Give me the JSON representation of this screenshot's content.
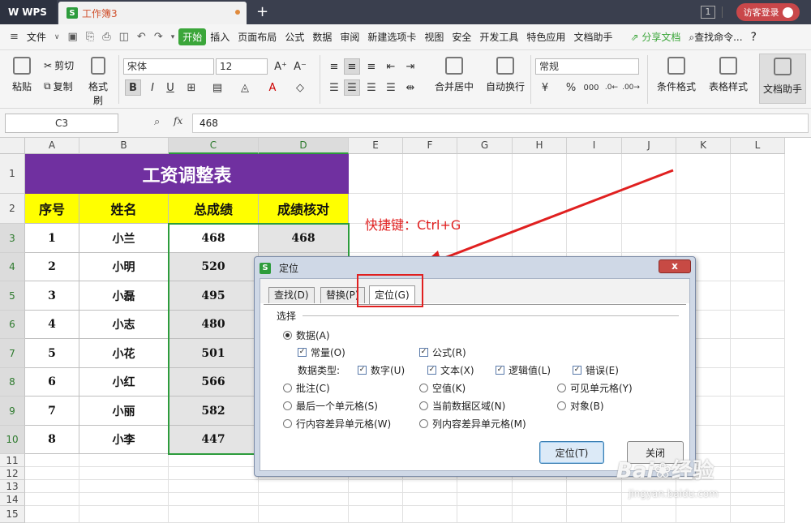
{
  "titlebar": {
    "app_name": "WPS",
    "doc_title": "工作簿3",
    "new_tab": "+",
    "tab_count": "1",
    "login": "访客登录"
  },
  "menubar": {
    "file": "文件",
    "items": [
      "开始",
      "插入",
      "页面布局",
      "公式",
      "数据",
      "审阅",
      "新建选项卡",
      "视图",
      "安全",
      "开发工具",
      "特色应用",
      "文档助手"
    ],
    "share": "分享文档",
    "search": "查找命令...",
    "help": "?"
  },
  "ribbon": {
    "paste": "粘贴",
    "cut": "剪切",
    "copy": "复制",
    "format_painter": "格式刷",
    "font_name": "宋体",
    "font_size": "12",
    "bold": "B",
    "italic": "I",
    "underline": "U",
    "merge_center": "合并居中",
    "wrap_text": "自动换行",
    "number_format": "常规",
    "percent": "%",
    "thousands": "000",
    "cond_format": "条件格式",
    "table_style": "表格样式",
    "doc_assistant": "文档助手"
  },
  "formula_bar": {
    "name_box": "C3",
    "fx": "fx",
    "value": "468"
  },
  "grid": {
    "columns": [
      "A",
      "B",
      "C",
      "D",
      "E",
      "F",
      "G",
      "H",
      "I",
      "J",
      "K",
      "L"
    ],
    "rows": [
      "1",
      "2",
      "3",
      "4",
      "5",
      "6",
      "7",
      "8",
      "9",
      "10",
      "11",
      "12",
      "13",
      "14",
      "15"
    ],
    "title": "工资调整表",
    "headers": [
      "序号",
      "姓名",
      "总成绩",
      "成绩核对"
    ],
    "data": [
      [
        "1",
        "小兰",
        "468",
        "468"
      ],
      [
        "2",
        "小明",
        "520",
        ""
      ],
      [
        "3",
        "小磊",
        "495",
        ""
      ],
      [
        "4",
        "小志",
        "480",
        ""
      ],
      [
        "5",
        "小花",
        "501",
        ""
      ],
      [
        "6",
        "小红",
        "566",
        ""
      ],
      [
        "7",
        "小丽",
        "582",
        ""
      ],
      [
        "8",
        "小李",
        "447",
        ""
      ]
    ]
  },
  "annotation": {
    "text": "快捷键：Ctrl+G",
    "color": "#e02020"
  },
  "dialog": {
    "title": "定位",
    "close": "x",
    "tabs": [
      "查找(D)",
      "替换(P)",
      "定位(G)"
    ],
    "group_label": "选择",
    "data_option": "数据(A)",
    "constants": "常量(O)",
    "formulas": "公式(R)",
    "data_types_label": "数据类型:",
    "types": [
      "数字(U)",
      "文本(X)",
      "逻辑值(L)",
      "错误(E)"
    ],
    "radios_row1": [
      "批注(C)",
      "空值(K)",
      "可见单元格(Y)"
    ],
    "radios_row2": [
      "最后一个单元格(S)",
      "当前数据区域(N)",
      "对象(B)"
    ],
    "radios_row3": [
      "行内容差异单元格(W)",
      "列内容差异单元格(M)"
    ],
    "ok": "定位(T)",
    "cancel": "关闭"
  },
  "watermark": {
    "brand": "Bai",
    "brand2": "经验",
    "url": "jingyan.baidu.com"
  },
  "colors": {
    "title_bg": "#7030a0",
    "header_bg": "#ffff00",
    "accent": "#3ba63a"
  }
}
